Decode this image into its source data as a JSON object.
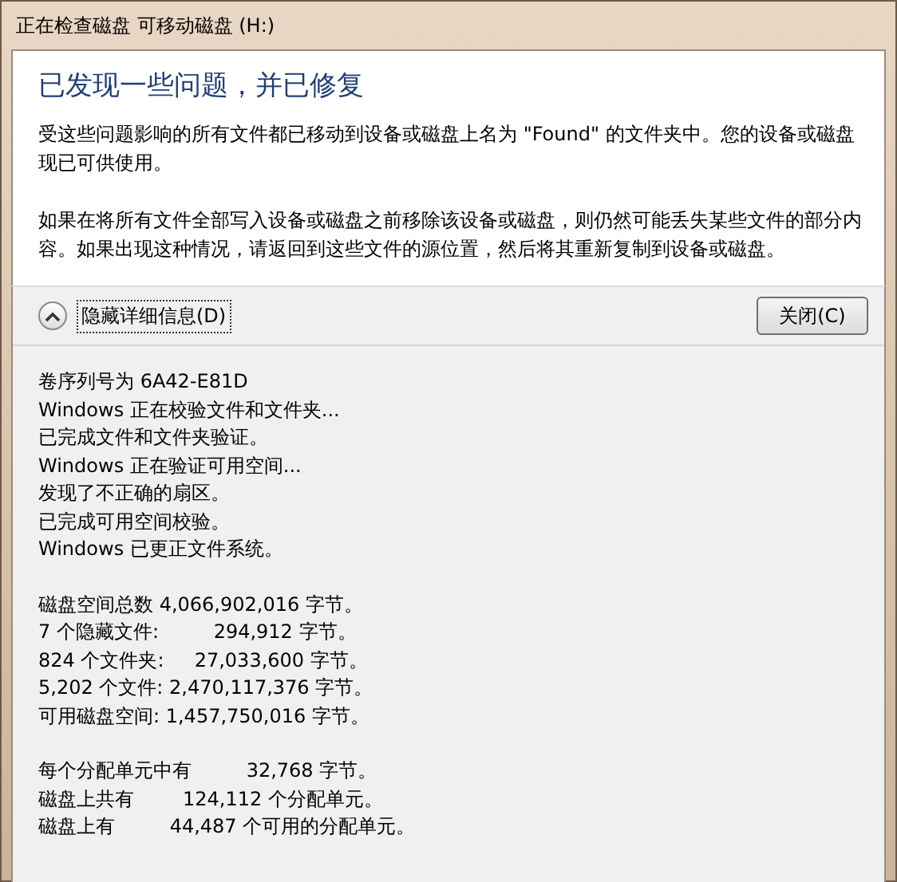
{
  "window": {
    "title": "正在检查磁盘 可移动磁盘 (H:)"
  },
  "heading": "已发现一些问题，并已修复",
  "paragraphs": [
    "受这些问题影响的所有文件都已移动到设备或磁盘上名为 \"Found\" 的文件夹中。您的设备或磁盘现已可供使用。",
    "如果在将所有文件全部写入设备或磁盘之前移除该设备或磁盘，则仍然可能丢失某些文件的部分内容。如果出现这种情况，请返回到这些文件的源位置，然后将其重新复制到设备或磁盘。"
  ],
  "details_toggle": {
    "label": "隐藏详细信息(D)",
    "expanded": true
  },
  "close_button": "关闭(C)",
  "details": [
    [
      "卷序列号为 6A42-E81D",
      "Windows 正在校验文件和文件夹...",
      "已完成文件和文件夹验证。",
      "Windows 正在验证可用空间...",
      "发现了不正确的扇区。",
      "已完成可用空间校验。",
      "Windows 已更正文件系统。"
    ],
    [
      "磁盘空间总数 4,066,902,016 字节。",
      "7 个隐藏文件:         294,912 字节。",
      "824 个文件夹:     27,033,600 字节。",
      "5,202 个文件: 2,470,117,376 字节。",
      "可用磁盘空间: 1,457,750,016 字节。"
    ],
    [
      "每个分配单元中有         32,768 字节。",
      "磁盘上共有        124,112 个分配单元。",
      "磁盘上有         44,487 个可用的分配单元。"
    ]
  ]
}
